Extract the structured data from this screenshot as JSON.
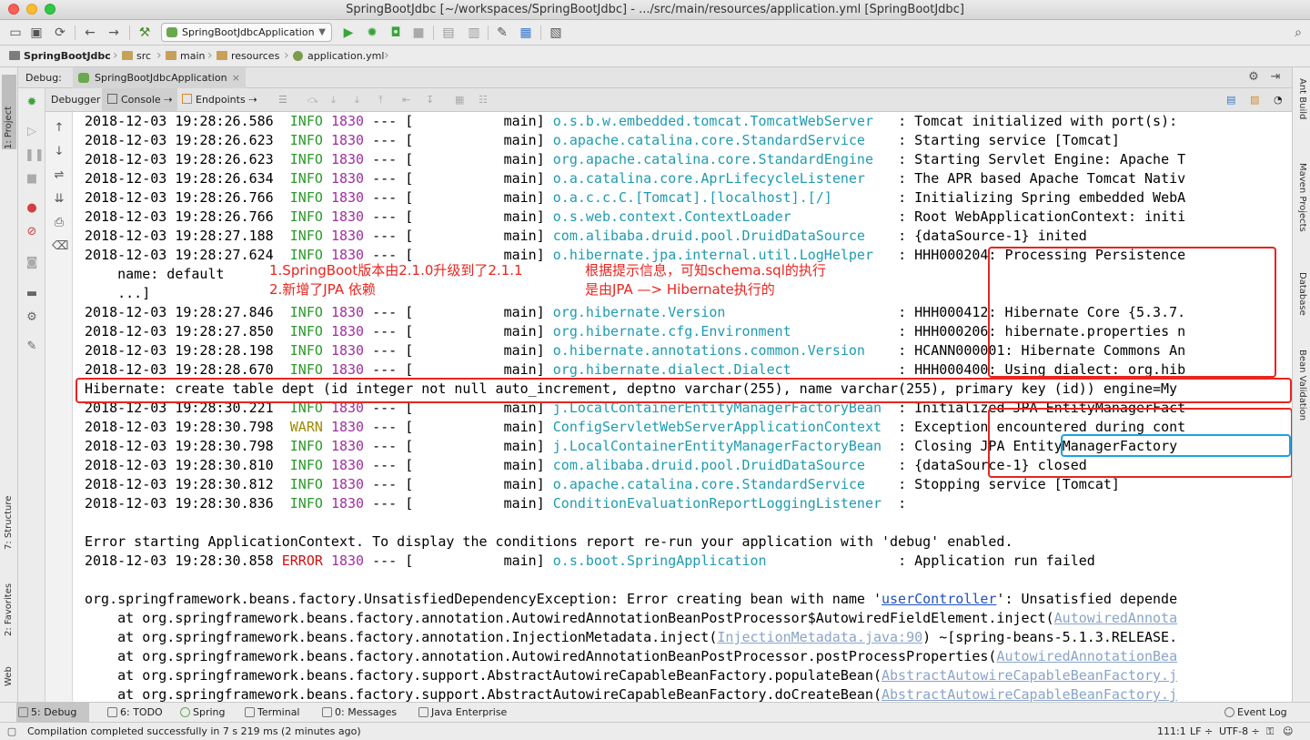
{
  "window": {
    "title": "SpringBootJdbc [~/workspaces/SpringBootJdbc] - .../src/main/resources/application.yml [SpringBootJdbc]"
  },
  "toolbar": {
    "run_config": "SpringBootJdbcApplication",
    "icons": [
      "open-folder-icon",
      "save-icon",
      "sync-icon",
      "back-icon",
      "forward-icon",
      "hammer-icon",
      "run-icon",
      "debug-icon",
      "coverage-icon",
      "stop-icon",
      "build-icon",
      "project-structure-icon",
      "wrench-icon",
      "sdk-icon",
      "vcs-icon",
      "search-icon"
    ]
  },
  "breadcrumbs": [
    "SpringBootJdbc",
    "src",
    "main",
    "resources",
    "application.yml"
  ],
  "debug": {
    "label": "Debug:",
    "session": "SpringBootJdbcApplication",
    "tabs": [
      "Debugger",
      "Console",
      "Endpoints"
    ]
  },
  "left_strip": {
    "project": "1: Project",
    "structure": "7: Structure",
    "favorites": "2: Favorites",
    "web": "Web"
  },
  "right_strip": {
    "ant": "Ant Build",
    "maven": "Maven Projects",
    "database": "Database",
    "bean": "Bean Validation"
  },
  "console": {
    "lines": [
      {
        "ts": "2018-12-03 19:28:26.586",
        "level": "INFO",
        "pid": "1830",
        "thread": "main",
        "logger": "o.s.b.w.embedded.tomcat.TomcatWebServer",
        "msg": "Tomcat initialized with port(s):"
      },
      {
        "ts": "2018-12-03 19:28:26.623",
        "level": "INFO",
        "pid": "1830",
        "thread": "main",
        "logger": "o.apache.catalina.core.StandardService",
        "msg": "Starting service [Tomcat]"
      },
      {
        "ts": "2018-12-03 19:28:26.623",
        "level": "INFO",
        "pid": "1830",
        "thread": "main",
        "logger": "org.apache.catalina.core.StandardEngine",
        "msg": "Starting Servlet Engine: Apache T"
      },
      {
        "ts": "2018-12-03 19:28:26.634",
        "level": "INFO",
        "pid": "1830",
        "thread": "main",
        "logger": "o.a.catalina.core.AprLifecycleListener",
        "msg": "The APR based Apache Tomcat Nativ"
      },
      {
        "ts": "2018-12-03 19:28:26.766",
        "level": "INFO",
        "pid": "1830",
        "thread": "main",
        "logger": "o.a.c.c.C.[Tomcat].[localhost].[/]",
        "msg": "Initializing Spring embedded WebA"
      },
      {
        "ts": "2018-12-03 19:28:26.766",
        "level": "INFO",
        "pid": "1830",
        "thread": "main",
        "logger": "o.s.web.context.ContextLoader",
        "msg": "Root WebApplicationContext: initi"
      },
      {
        "ts": "2018-12-03 19:28:27.188",
        "level": "INFO",
        "pid": "1830",
        "thread": "main",
        "logger": "com.alibaba.druid.pool.DruidDataSource",
        "msg": "{dataSource-1} inited"
      },
      {
        "ts": "2018-12-03 19:28:27.624",
        "level": "INFO",
        "pid": "1830",
        "thread": "main",
        "logger": "o.hibernate.jpa.internal.util.LogHelper",
        "msg": "HHH000204: Processing Persistence"
      },
      {
        "ts": "2018-12-03 19:28:27.846",
        "level": "INFO",
        "pid": "1830",
        "thread": "main",
        "logger": "org.hibernate.Version",
        "msg": "HHH000412: Hibernate Core {5.3.7."
      },
      {
        "ts": "2018-12-03 19:28:27.850",
        "level": "INFO",
        "pid": "1830",
        "thread": "main",
        "logger": "org.hibernate.cfg.Environment",
        "msg": "HHH000206: hibernate.properties n"
      },
      {
        "ts": "2018-12-03 19:28:28.198",
        "level": "INFO",
        "pid": "1830",
        "thread": "main",
        "logger": "o.hibernate.annotations.common.Version",
        "msg": "HCANN000001: Hibernate Commons An"
      },
      {
        "ts": "2018-12-03 19:28:28.670",
        "level": "INFO",
        "pid": "1830",
        "thread": "main",
        "logger": "org.hibernate.dialect.Dialect",
        "msg": "HHH000400: Using dialect: org.hib"
      },
      {
        "ts": "2018-12-03 19:28:30.221",
        "level": "INFO",
        "pid": "1830",
        "thread": "main",
        "logger": "j.LocalContainerEntityManagerFactoryBean",
        "msg": "Initialized JPA EntityManagerFact"
      },
      {
        "ts": "2018-12-03 19:28:30.798",
        "level": "WARN",
        "pid": "1830",
        "thread": "main",
        "logger": "ConfigServletWebServerApplicationContext",
        "msg": "Exception encountered during cont"
      },
      {
        "ts": "2018-12-03 19:28:30.798",
        "level": "INFO",
        "pid": "1830",
        "thread": "main",
        "logger": "j.LocalContainerEntityManagerFactoryBean",
        "msg": "Closing JPA EntityManagerFactory"
      },
      {
        "ts": "2018-12-03 19:28:30.810",
        "level": "INFO",
        "pid": "1830",
        "thread": "main",
        "logger": "com.alibaba.druid.pool.DruidDataSource",
        "msg": "{dataSource-1} closed"
      },
      {
        "ts": "2018-12-03 19:28:30.812",
        "level": "INFO",
        "pid": "1830",
        "thread": "main",
        "logger": "o.apache.catalina.core.StandardService",
        "msg": "Stopping service [Tomcat]"
      },
      {
        "ts": "2018-12-03 19:28:30.836",
        "level": "INFO",
        "pid": "1830",
        "thread": "main",
        "logger": "ConditionEvaluationReportLoggingListener",
        "msg": ""
      },
      {
        "ts": "2018-12-03 19:28:30.858",
        "level": "ERROR",
        "pid": "1830",
        "thread": "main",
        "logger": "o.s.boot.SpringApplication",
        "msg": "Application run failed"
      }
    ],
    "extra_name": "    name: default",
    "extra_dots": "    ...]",
    "hibernate_sql": "Hibernate: create table dept (id integer not null auto_increment, deptno varchar(255), name varchar(255), primary key (id)) engine=My",
    "error_starting": "Error starting ApplicationContext. To display the conditions report re-run your application with 'debug' enabled.",
    "exception_prefix": "org.springframework.beans.factory.UnsatisfiedDependencyException: Error creating bean with name '",
    "exception_bean": "userController",
    "exception_suffix": "': Unsatisfied depende",
    "stack": [
      {
        "text": "    at org.springframework.beans.factory.annotation.AutowiredAnnotationBeanPostProcessor$AutowiredFieldElement.inject(",
        "link": "AutowiredAnnota"
      },
      {
        "text": "    at org.springframework.beans.factory.annotation.InjectionMetadata.inject(",
        "link": "InjectionMetadata.java:90",
        "tail": ") ~[spring-beans-5.1.3.RELEASE."
      },
      {
        "text": "    at org.springframework.beans.factory.annotation.AutowiredAnnotationBeanPostProcessor.postProcessProperties(",
        "link": "AutowiredAnnotationBea"
      },
      {
        "text": "    at org.springframework.beans.factory.support.AbstractAutowireCapableBeanFactory.populateBean(",
        "link": "AbstractAutowireCapableBeanFactory.j"
      },
      {
        "text": "    at org.springframework.beans.factory.support.AbstractAutowireCapableBeanFactory.doCreateBean(",
        "link": "AbstractAutowireCapableBeanFactory.j"
      }
    ],
    "separator": "---",
    "bracket_open": "[",
    "bracket_close": "]",
    "colon": ":"
  },
  "annotations": {
    "note1_line1": "1.SpringBoot版本由2.1.0升级到了2.1.1",
    "note1_line2": "2.新增了JPA 依赖",
    "note2_line1": "根据提示信息，可知schema.sql的执行",
    "note2_line2": "是由JPA —> Hibernate执行的"
  },
  "bottom_tabs": [
    {
      "label": "5: Debug",
      "active": true
    },
    {
      "label": "6: TODO"
    },
    {
      "label": "Spring"
    },
    {
      "label": "Terminal"
    },
    {
      "label": "0: Messages"
    },
    {
      "label": "Java Enterprise"
    }
  ],
  "event_log": "Event Log",
  "status": {
    "message": "Compilation completed successfully in 7 s 219 ms (2 minutes ago)",
    "position": "111:1",
    "line_sep": "LF ÷",
    "encoding": "UTF-8 ÷"
  },
  "colors": {
    "info": "#2a9a2a",
    "warn": "#a08a00",
    "error": "#d01010",
    "logger": "#1f9bb0",
    "annotation": "#e8251f",
    "highlight": "#1aa3e0"
  }
}
